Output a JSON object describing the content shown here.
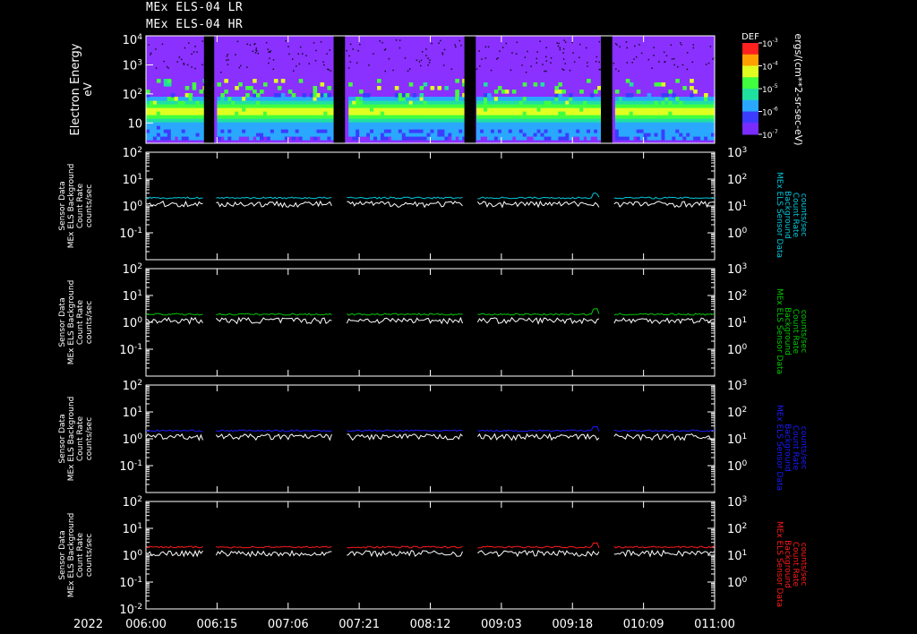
{
  "header": {
    "line1": "MEx ELS-04 LR",
    "line2": "MEx ELS-04 HR"
  },
  "colors": {
    "background": "#000000",
    "panel1": "#00c8dc",
    "panel2": "#00c800",
    "panel3": "#1a1aff",
    "panel4": "#ff1a1a",
    "white_series": "#ffffff"
  },
  "chart_data": [
    {
      "type": "heatmap",
      "ylabel": "Electron Energy",
      "yunit": "eV",
      "yscale": "log",
      "ylim": [
        2,
        10000
      ],
      "yticks": [
        "10",
        "10",
        "10",
        "10"
      ],
      "ytick_exps": [
        "4",
        "3",
        "2",
        ""
      ],
      "colorbar": {
        "title": "DEF",
        "label": "ergs/(cm**2-sr-sec-eV)",
        "ticks": [
          "10",
          "10",
          "10",
          "10",
          "10"
        ],
        "tick_exps": [
          "-3",
          "-4",
          "-5",
          "-6",
          "-7"
        ],
        "range": [
          1e-07,
          0.001
        ]
      },
      "data_gaps": [
        "006:10",
        "007:16",
        "008:28",
        "009:25"
      ]
    },
    {
      "type": "line",
      "ylabel": [
        "Sensor Data",
        "MEx ELS Background",
        "Count Rate",
        "counts/sec"
      ],
      "right_label": [
        "MEx ELS Sensor Data",
        "Background",
        "Count Rate",
        "counts/sec"
      ],
      "yscale": "log",
      "ylim": [
        0.01,
        100
      ],
      "yticks_left": [
        "10",
        "10",
        "10",
        "10"
      ],
      "yticks_left_exps": [
        "1",
        "0",
        "-1",
        ""
      ],
      "top_left": "10",
      "top_left_exp": "2",
      "right_ylim": [
        0.1,
        1000
      ],
      "yticks_right": [
        "10",
        "10",
        "10"
      ],
      "yticks_right_exps": [
        "2",
        "1",
        "0"
      ],
      "top_right": "10",
      "top_right_exp": "3",
      "series": [
        {
          "name": "Sensor Data",
          "color": "#00c8dc",
          "level": 2.0
        },
        {
          "name": "Background",
          "color": "#ffffff",
          "level": 1.2
        }
      ]
    },
    {
      "type": "line",
      "ylabel": [
        "Sensor Data",
        "MEx ELS Background",
        "Count Rate",
        "counts/sec"
      ],
      "right_label": [
        "MEx ELS Sensor Data",
        "Background",
        "Count Rate",
        "counts/sec"
      ],
      "yscale": "log",
      "ylim": [
        0.01,
        100
      ],
      "yticks_left": [
        "10",
        "10",
        "10"
      ],
      "yticks_left_exps": [
        "1",
        "0",
        "-1"
      ],
      "top_left": "10",
      "top_left_exp": "2",
      "right_ylim": [
        0.1,
        1000
      ],
      "yticks_right": [
        "10",
        "10",
        "10"
      ],
      "yticks_right_exps": [
        "2",
        "1",
        "0"
      ],
      "top_right": "10",
      "top_right_exp": "3",
      "series": [
        {
          "name": "Sensor Data",
          "color": "#00c800",
          "level": 2.0
        },
        {
          "name": "Background",
          "color": "#ffffff",
          "level": 1.2
        }
      ]
    },
    {
      "type": "line",
      "ylabel": [
        "Sensor Data",
        "MEx ELS Background",
        "Count Rate",
        "counts/sec"
      ],
      "right_label": [
        "MEx ELS Sensor Data",
        "Background",
        "Count Rate",
        "counts/sec"
      ],
      "yscale": "log",
      "ylim": [
        0.01,
        100
      ],
      "yticks_left": [
        "10",
        "10",
        "10"
      ],
      "yticks_left_exps": [
        "1",
        "0",
        "-1"
      ],
      "top_left": "10",
      "top_left_exp": "2",
      "right_ylim": [
        0.1,
        1000
      ],
      "yticks_right": [
        "10",
        "10",
        "10"
      ],
      "yticks_right_exps": [
        "2",
        "1",
        "0"
      ],
      "top_right": "10",
      "top_right_exp": "3",
      "series": [
        {
          "name": "Sensor Data",
          "color": "#1a1aff",
          "level": 2.0
        },
        {
          "name": "Background",
          "color": "#ffffff",
          "level": 1.2
        }
      ]
    },
    {
      "type": "line",
      "ylabel": [
        "Sensor Data",
        "MEx ELS Background",
        "Count Rate",
        "counts/sec"
      ],
      "right_label": [
        "MEx ELS Sensor Data",
        "Background",
        "Count Rate",
        "counts/sec"
      ],
      "yscale": "log",
      "ylim": [
        0.01,
        100
      ],
      "yticks_left": [
        "10",
        "10",
        "10"
      ],
      "yticks_left_exps": [
        "1",
        "0",
        "-1"
      ],
      "top_left": "10",
      "top_left_exp": "2",
      "bottom_left": "10",
      "bottom_left_exp": "-2",
      "right_ylim": [
        0.1,
        1000
      ],
      "yticks_right": [
        "10",
        "10",
        "10"
      ],
      "yticks_right_exps": [
        "2",
        "1",
        "0"
      ],
      "top_right": "10",
      "top_right_exp": "3",
      "series": [
        {
          "name": "Sensor Data",
          "color": "#ff1a1a",
          "level": 2.0
        },
        {
          "name": "Background",
          "color": "#ffffff",
          "level": 1.2
        }
      ]
    }
  ],
  "xaxis": {
    "year": "2022",
    "ticks": [
      "006:00",
      "006:15",
      "007:06",
      "007:21",
      "008:12",
      "009:03",
      "009:18",
      "010:09",
      "011:00"
    ]
  }
}
